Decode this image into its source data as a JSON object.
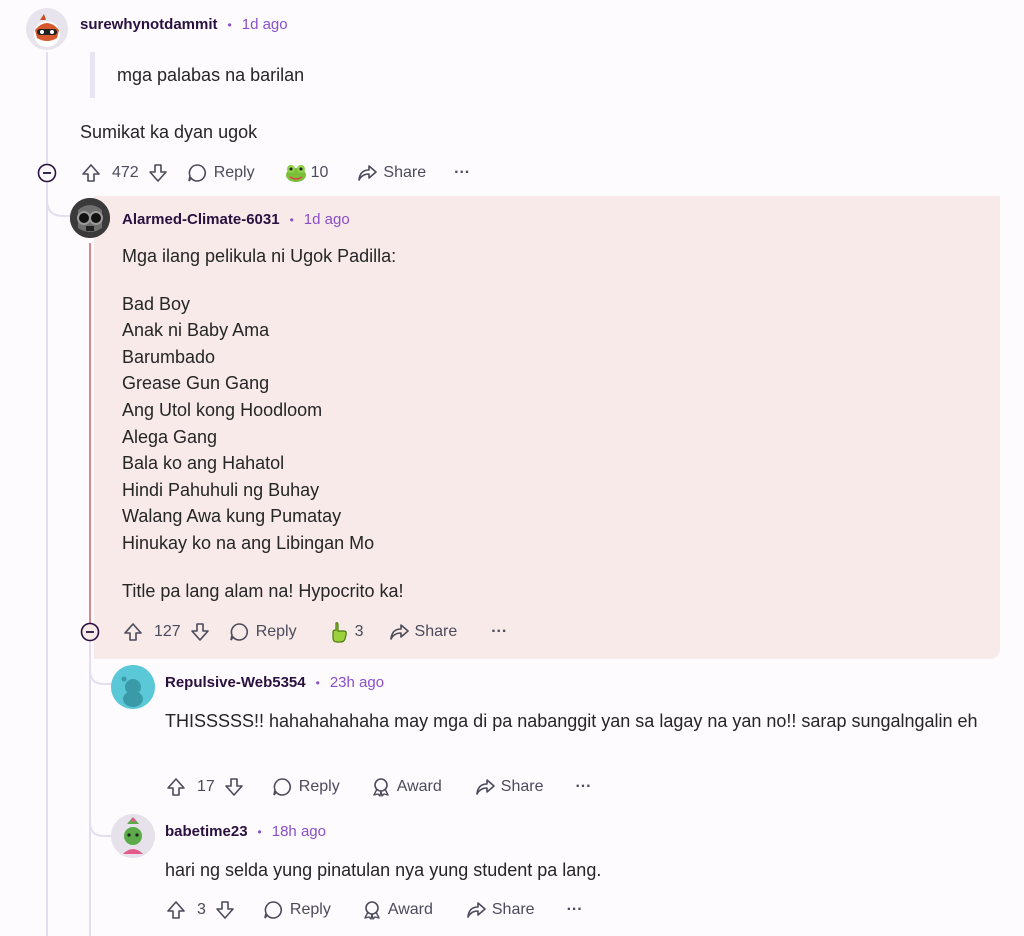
{
  "comments": [
    {
      "author": "surewhynotdammit",
      "time": "1d ago",
      "quote": "mga palabas na barilan",
      "body": "Sumikat ka dyan ugok",
      "votes": "472",
      "reply_label": "Reply",
      "award_count": "10",
      "share_label": "Share",
      "more_label": "···"
    },
    {
      "author": "Alarmed-Climate-6031",
      "time": "1d ago",
      "intro": "Mga ilang pelikula ni Ugok Padilla:",
      "films": [
        "Bad Boy",
        "Anak ni Baby Ama",
        "Barumbado",
        "Grease Gun Gang",
        "Ang Utol kong Hoodloom",
        "Alega Gang",
        "Bala ko ang Hahatol",
        "Hindi Pahuhuli ng Buhay",
        "Walang Awa kung Pumatay",
        "Hinukay ko na ang Libingan Mo"
      ],
      "outro": "Title pa lang alam na! Hypocrito ka!",
      "votes": "127",
      "reply_label": "Reply",
      "award_count": "3",
      "share_label": "Share",
      "more_label": "···"
    },
    {
      "author": "Repulsive-Web5354",
      "time": "23h ago",
      "body": "THISSSSS!! hahahahahaha may mga di pa nabanggit yan sa lagay na yan no!! sarap sungalngalin eh",
      "votes": "17",
      "reply_label": "Reply",
      "award_label": "Award",
      "share_label": "Share",
      "more_label": "···"
    },
    {
      "author": "babetime23",
      "time": "18h ago",
      "body": "hari ng selda yung pinatulan nya yung student pa lang.",
      "votes": "3",
      "reply_label": "Reply",
      "award_label": "Award",
      "share_label": "Share",
      "more_label": "···"
    }
  ],
  "colors": {
    "username": "#2a1040",
    "timestamp": "#8a4fc8",
    "highlight_bg": "#f7eae8",
    "thread_line": "#e4def0"
  }
}
